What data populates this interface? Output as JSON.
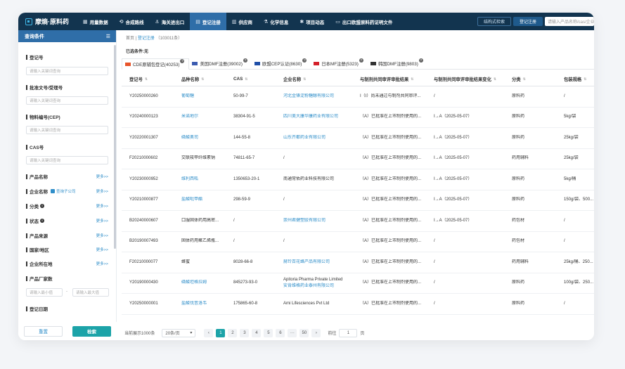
{
  "app": {
    "brand": "摩熵·原料药"
  },
  "nav": {
    "items": [
      {
        "icon": "▦",
        "label": "用量数据"
      },
      {
        "icon": "⟲",
        "label": "合成路线"
      },
      {
        "icon": "⚓",
        "label": "海关进出口"
      },
      {
        "icon": "▤",
        "label": "登记注册"
      },
      {
        "icon": "▥",
        "label": "供应商"
      },
      {
        "icon": "⚗",
        "label": "化学信息"
      },
      {
        "icon": "✱",
        "label": "项目动态"
      },
      {
        "icon": "▭",
        "label": "出口欧盟原料药证明文件"
      }
    ],
    "active_index": 3,
    "structure_search": "结构式检索",
    "register_btn": "登记注册",
    "search_placeholder": "请输入产品名称/cas/企业名称"
  },
  "sidebar": {
    "title": "查询条件",
    "menu_icon": "☰",
    "fields": {
      "reg_no": {
        "label": "登记号",
        "placeholder": "请输入关键词查询"
      },
      "approval_no": {
        "label": "批准文号/受理号",
        "placeholder": "请输入关键词查询"
      },
      "material_no": {
        "label": "物料编号(CEP)",
        "placeholder": "请输入关键词查询"
      },
      "cas": {
        "label": "CAS号",
        "placeholder": "请输入关键词查询"
      },
      "product_name": {
        "label": "产品名称",
        "more": "更多>>"
      },
      "company": {
        "label": "企业名称",
        "check": "查询子公司",
        "more": "更多>>"
      },
      "category": {
        "label": "分类",
        "more": "更多>>"
      },
      "status": {
        "label": "状态",
        "more": "更多>>"
      },
      "source": {
        "label": "产品来源",
        "more": "更多>>"
      },
      "country": {
        "label": "国家/地区",
        "more": "更多>>"
      },
      "location": {
        "label": "企业所在地",
        "more": "更多>>"
      },
      "manufacturer_count": {
        "label": "产品厂家数",
        "min_placeholder": "请输入最小值",
        "dash": "-",
        "max_placeholder": "请输入最大值"
      },
      "reg_date": {
        "label": "登记日期"
      }
    },
    "reset_label": "重置",
    "search_label": "检索"
  },
  "main": {
    "breadcrumb": {
      "home": "首页",
      "sep": "|",
      "current": "登记注册",
      "count": "（103011条）"
    },
    "filters_label": "已选条件:无",
    "tabs": [
      {
        "label": "CDE原辅包登记(40253)",
        "flag_color": "#e8542a"
      },
      {
        "label": "美国DMF注册(39002)",
        "flag_color": "#3b5bb0"
      },
      {
        "label": "欧盟CEP认证(8630)",
        "flag_color": "#1f4fa8"
      },
      {
        "label": "日本MF注册(5323)",
        "flag_color": "#d4202a"
      },
      {
        "label": "韩国DMF注册(9803)",
        "flag_color": "#333333"
      }
    ],
    "tab_q": "?",
    "columns": [
      "登记号",
      "品种名称",
      "CAS",
      "企业名称",
      "与制剂共同审评审批结果",
      "与制剂共同审评审批结果变化",
      "分类",
      "包装规格"
    ],
    "sort_icon": "⇅",
    "rows": [
      [
        "Y20250000260",
        "葡萄糖",
        "50-99-7",
        "河北金锋淀粉糖醇有限公司",
        "I（I）尚未通过与制剂共同审评...",
        "/",
        "原料药",
        "/"
      ],
      [
        "Y20240000123",
        "米诺地尔",
        "38304-91-5",
        "四川美大康华康药业有限公司",
        "（A）已批准在上市制剂使用的...",
        "I→A（2025-05-07）",
        "原料药",
        "5kg/袋"
      ],
      [
        "Y20220001307",
        "磷酸奥司",
        "144-55-8",
        "山东齐都药业有限公司",
        "（A）已批准在上市制剂使用的...",
        "I→A（2025-05-07）",
        "原料药",
        "25kg/袋"
      ],
      [
        "F20210000602",
        "交联羧甲纤维素钠",
        "74811-65-7",
        "/",
        "（A）已批准在上市制剂使用的...",
        "I→A（2025-05-07）",
        "药用辅料",
        "25kg/袋"
      ],
      [
        "Y20230000952",
        "维利西呱",
        "1350653-20-1",
        "南通常佑药业科技有限公司",
        "（A）已批准在上市制剂使用的...",
        "I→A（2025-05-07）",
        "原料药",
        "5kg/桶"
      ],
      [
        "Y20210000877",
        "盐酸吡甲酯",
        "298-59-9",
        "/",
        "（A）已批准在上市制剂使用的...",
        "I→A（2025-05-07）",
        "原料药",
        "150g/袋、500..."
      ],
      [
        "B20240000607",
        "口服固体药用高密...",
        "/",
        "崇州君健塑胶有限公司",
        "（A）已批准在上市制剂使用的...",
        "I→A（2025-05-07）",
        "药包材",
        "/"
      ],
      [
        "B20190007493",
        "固体药用聚乙烯瓶...",
        "/",
        "/",
        "（A）已批准在上市制剂使用的...",
        "/",
        "药包材",
        "/"
      ],
      [
        "F20210000077",
        "蜂蜜",
        "8028-66-8",
        "赫玲百花蜂产品有限公司",
        "（A）已批准在上市制剂使用的...",
        "/",
        "药用辅料",
        "25kg/桶、250..."
      ],
      [
        "Y20190000430",
        "磷酸坦格拉姆",
        "845273-93-0",
        "Apitoria Pharma Private Limited|安肯维格药业泰州有限公司",
        "（A）已批准在上市制剂使用的...",
        "/",
        "原料药",
        "100g/袋、250..."
      ],
      [
        "Y20250000001",
        "盐酸伐昔洛韦",
        "175865-60-8",
        "Ami Lifesciences Pvt Ltd",
        "（A）已批准在上市制剂使用的...",
        "/",
        "原料药",
        "/"
      ]
    ],
    "pager": {
      "total": "当前展示1000条",
      "size": "20条/页",
      "size_arrow": "▾",
      "prev": "‹",
      "pages": [
        "1",
        "2",
        "3",
        "4",
        "5",
        "6",
        "···",
        "50"
      ],
      "active": "1",
      "next": "›",
      "jump_prefix": "前往",
      "jump_value": "1",
      "jump_suffix": "页"
    }
  },
  "colors": {
    "nav_bg": "#12344f",
    "accent": "#2f6ea8",
    "link": "#2f8ec9",
    "teal": "#1ca3a8"
  }
}
